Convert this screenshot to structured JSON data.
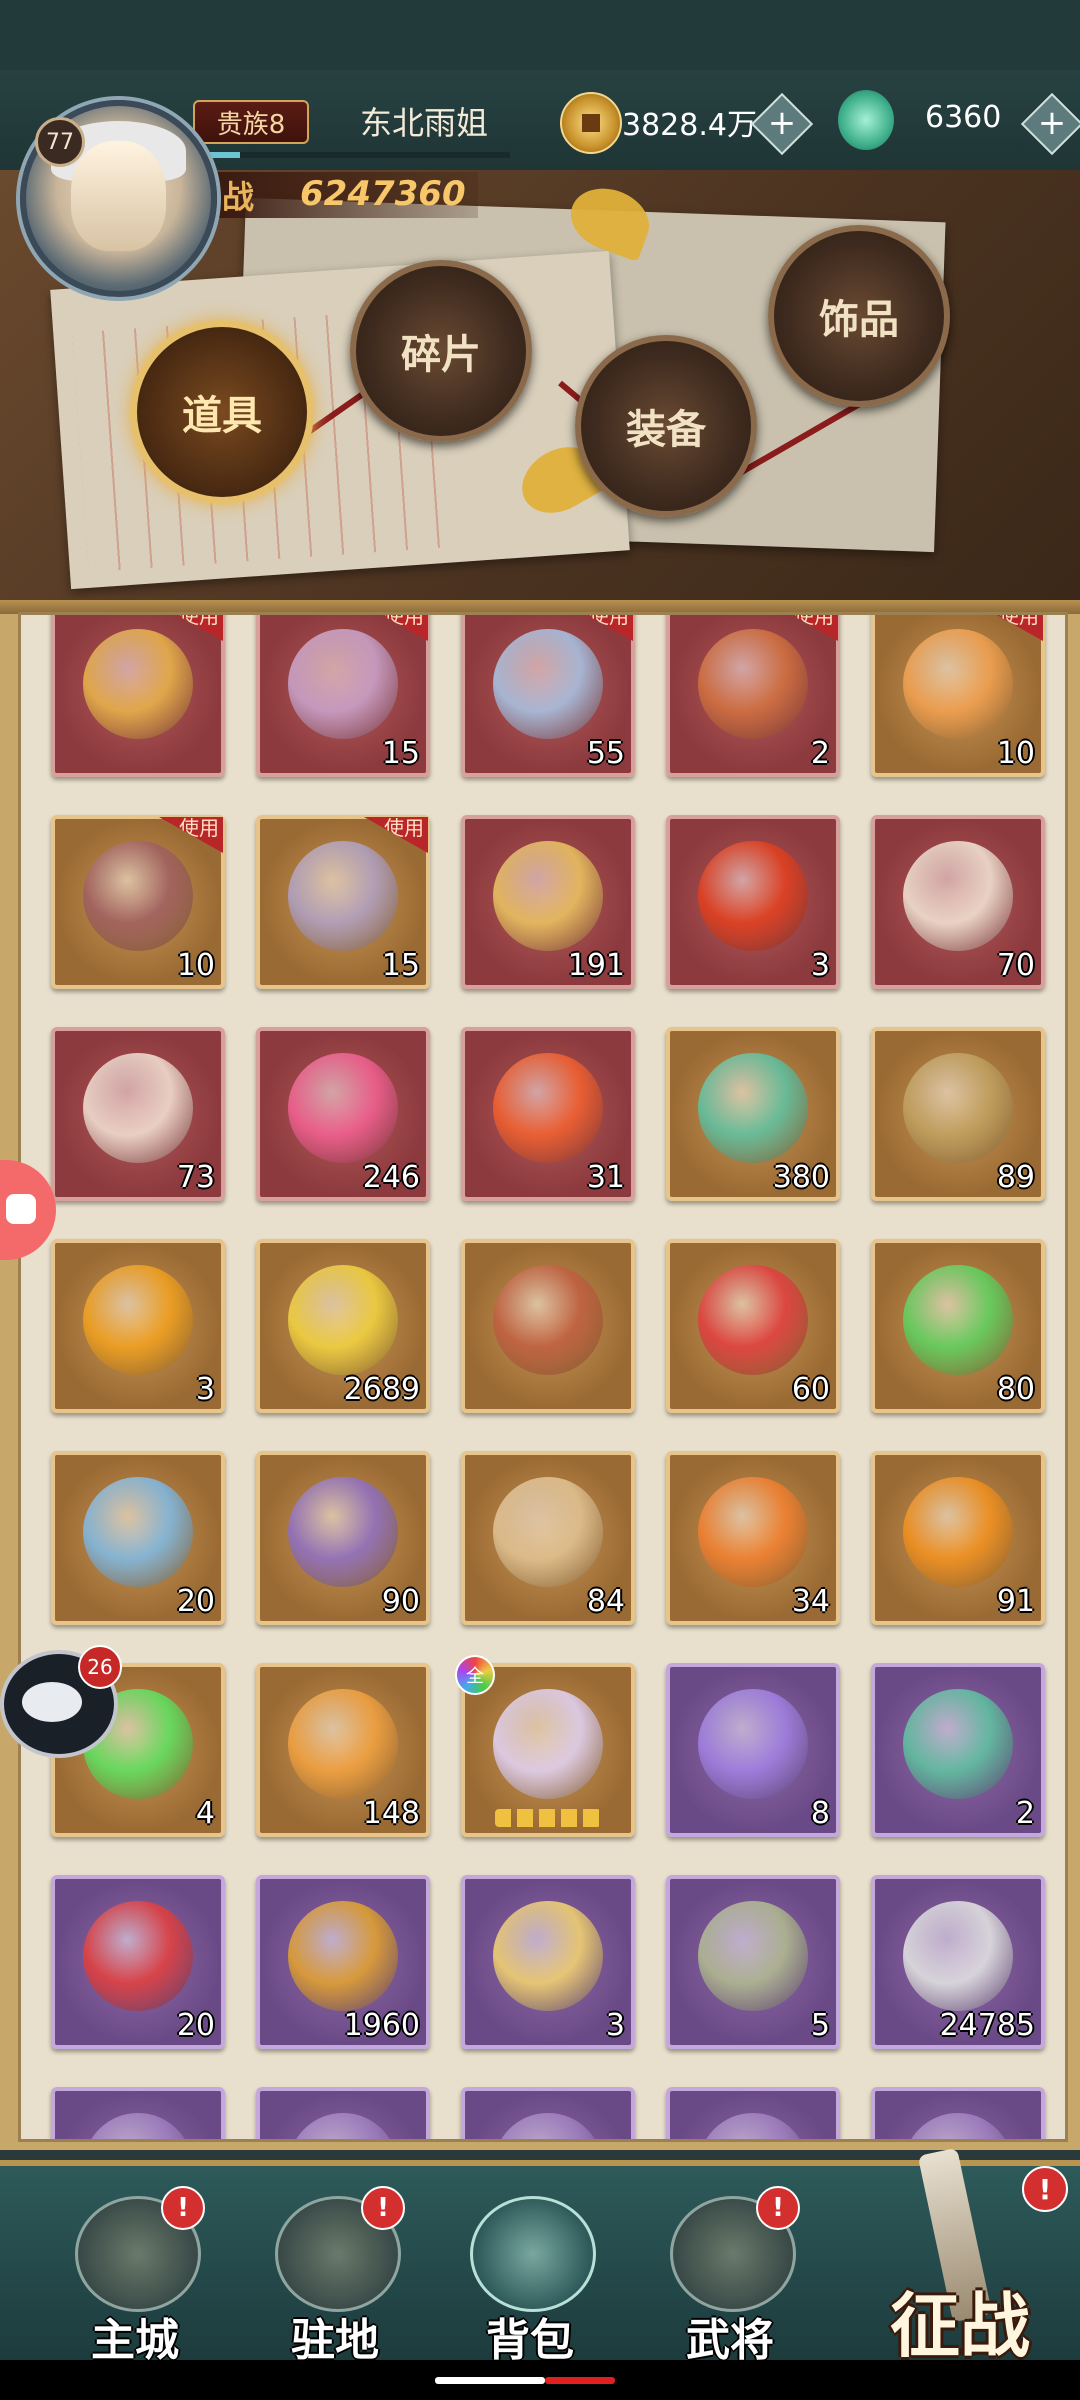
{
  "header": {
    "level": "77",
    "vip": "贵族8",
    "player_name": "东北雨姐",
    "gold": "3828.4万",
    "jade": "6360",
    "power_icon": "战",
    "power": "6247360",
    "plus": "+",
    "xp_fraction": 0.1
  },
  "tabs": [
    {
      "label": "道具",
      "active": true
    },
    {
      "label": "碎片",
      "active": false
    },
    {
      "label": "装备",
      "active": false
    },
    {
      "label": "饰品",
      "active": false
    }
  ],
  "inventory": {
    "use_label": "使用",
    "all_label": "全",
    "items": [
      {
        "color": "red",
        "count": "",
        "use": true,
        "art": "card-icon",
        "hue": "#e6b04a"
      },
      {
        "color": "red",
        "count": "15",
        "use": true,
        "art": "chest-icon",
        "hue": "#c9a0c8"
      },
      {
        "color": "red",
        "count": "55",
        "use": true,
        "art": "chest-icon",
        "hue": "#a8c0e0"
      },
      {
        "color": "red",
        "count": "2",
        "use": true,
        "art": "chest-icon",
        "hue": "#d07040"
      },
      {
        "color": "gold",
        "count": "10",
        "use": true,
        "art": "mystery-icon",
        "hue": "#f0a050"
      },
      {
        "color": "gold",
        "count": "10",
        "use": true,
        "art": "chest-icon",
        "hue": "#a06060"
      },
      {
        "color": "gold",
        "count": "15",
        "use": true,
        "art": "chest-icon",
        "hue": "#b0a0c0"
      },
      {
        "color": "red",
        "count": "191",
        "use": false,
        "art": "coin-icon",
        "hue": "#e8c060"
      },
      {
        "color": "red",
        "count": "3",
        "use": false,
        "art": "token-icon",
        "hue": "#e04020"
      },
      {
        "color": "red",
        "count": "70",
        "use": false,
        "art": "horn-icon",
        "hue": "#f0e0d0"
      },
      {
        "color": "red",
        "count": "73",
        "use": false,
        "art": "shell-icon",
        "hue": "#f0dcd0"
      },
      {
        "color": "red",
        "count": "246",
        "use": false,
        "art": "crystal-icon",
        "hue": "#f06090"
      },
      {
        "color": "red",
        "count": "31",
        "use": false,
        "art": "gem-icon",
        "hue": "#f06030"
      },
      {
        "color": "gold",
        "count": "380",
        "use": false,
        "art": "emblem-icon",
        "hue": "#60c0a0"
      },
      {
        "color": "gold",
        "count": "89",
        "use": false,
        "art": "helmet-icon",
        "hue": "#c0a060"
      },
      {
        "color": "gold",
        "count": "3",
        "use": false,
        "art": "token-icon",
        "hue": "#f0a020"
      },
      {
        "color": "gold",
        "count": "2689",
        "use": false,
        "art": "orb-icon",
        "hue": "#f0d040"
      },
      {
        "color": "gold",
        "count": "",
        "use": false,
        "art": "arrow-icon",
        "hue": "#c06040"
      },
      {
        "color": "gold",
        "count": "60",
        "use": false,
        "art": "gem-icon",
        "hue": "#e04040"
      },
      {
        "color": "gold",
        "count": "80",
        "use": false,
        "art": "crystal-icon",
        "hue": "#60d060"
      },
      {
        "color": "gold",
        "count": "20",
        "use": false,
        "art": "fish-icon",
        "hue": "#80b8e0"
      },
      {
        "color": "gold",
        "count": "90",
        "use": false,
        "art": "cloth-icon",
        "hue": "#9070c0"
      },
      {
        "color": "gold",
        "count": "84",
        "use": false,
        "art": "coin-icon",
        "hue": "#e0c090"
      },
      {
        "color": "gold",
        "count": "34",
        "use": false,
        "art": "orb-icon",
        "hue": "#f08030"
      },
      {
        "color": "gold",
        "count": "91",
        "use": false,
        "art": "gem-icon",
        "hue": "#f09020"
      },
      {
        "color": "gold",
        "count": "4",
        "use": false,
        "art": "fire-icon",
        "hue": "#60e060"
      },
      {
        "color": "gold",
        "count": "148",
        "use": false,
        "art": "fire-icon",
        "hue": "#f0a040"
      },
      {
        "color": "gold",
        "count": "",
        "use": false,
        "all": true,
        "art": "orb-icon",
        "hue": "#e0d0f0",
        "stars": true
      },
      {
        "color": "purple",
        "count": "8",
        "use": false,
        "art": "token-icon",
        "hue": "#a080e0"
      },
      {
        "color": "purple",
        "count": "2",
        "use": false,
        "art": "arrow-icon",
        "hue": "#60c0a0"
      },
      {
        "color": "purple",
        "count": "20",
        "use": false,
        "art": "scroll-icon",
        "hue": "#e04040"
      },
      {
        "color": "purple",
        "count": "1960",
        "use": false,
        "art": "armillary-icon",
        "hue": "#e0a030"
      },
      {
        "color": "purple",
        "count": "3",
        "use": false,
        "art": "scroll-icon",
        "hue": "#f0d070"
      },
      {
        "color": "purple",
        "count": "5",
        "use": false,
        "art": "key-icon",
        "hue": "#b0b890"
      },
      {
        "color": "purple",
        "count": "24785",
        "use": false,
        "art": "totem-icon",
        "hue": "#e0e0e0"
      },
      {
        "color": "purple",
        "count": "",
        "use": false,
        "art": "item-icon",
        "hue": "#a080c0"
      },
      {
        "color": "purple",
        "count": "",
        "use": false,
        "art": "item-icon",
        "hue": "#a080c0"
      },
      {
        "color": "purple",
        "count": "",
        "use": false,
        "art": "item-icon",
        "hue": "#a080c0"
      },
      {
        "color": "purple",
        "count": "",
        "use": false,
        "art": "item-icon",
        "hue": "#a080c0"
      },
      {
        "color": "purple",
        "count": "",
        "use": false,
        "art": "item-icon",
        "hue": "#a080c0"
      }
    ]
  },
  "chat": {
    "badge": "26"
  },
  "nav": {
    "items": [
      {
        "label": "主城",
        "alert": "!"
      },
      {
        "label": "驻地",
        "alert": "!"
      },
      {
        "label": "背包",
        "alert": ""
      },
      {
        "label": "武将",
        "alert": "!"
      }
    ],
    "campaign": "征战",
    "campaign_alert": "!"
  },
  "colors": {
    "accent": "#e6c06a",
    "red_frame": "#d8a09a",
    "purple_frame": "#c4a8dc",
    "gold_frame": "#e6c48a"
  }
}
